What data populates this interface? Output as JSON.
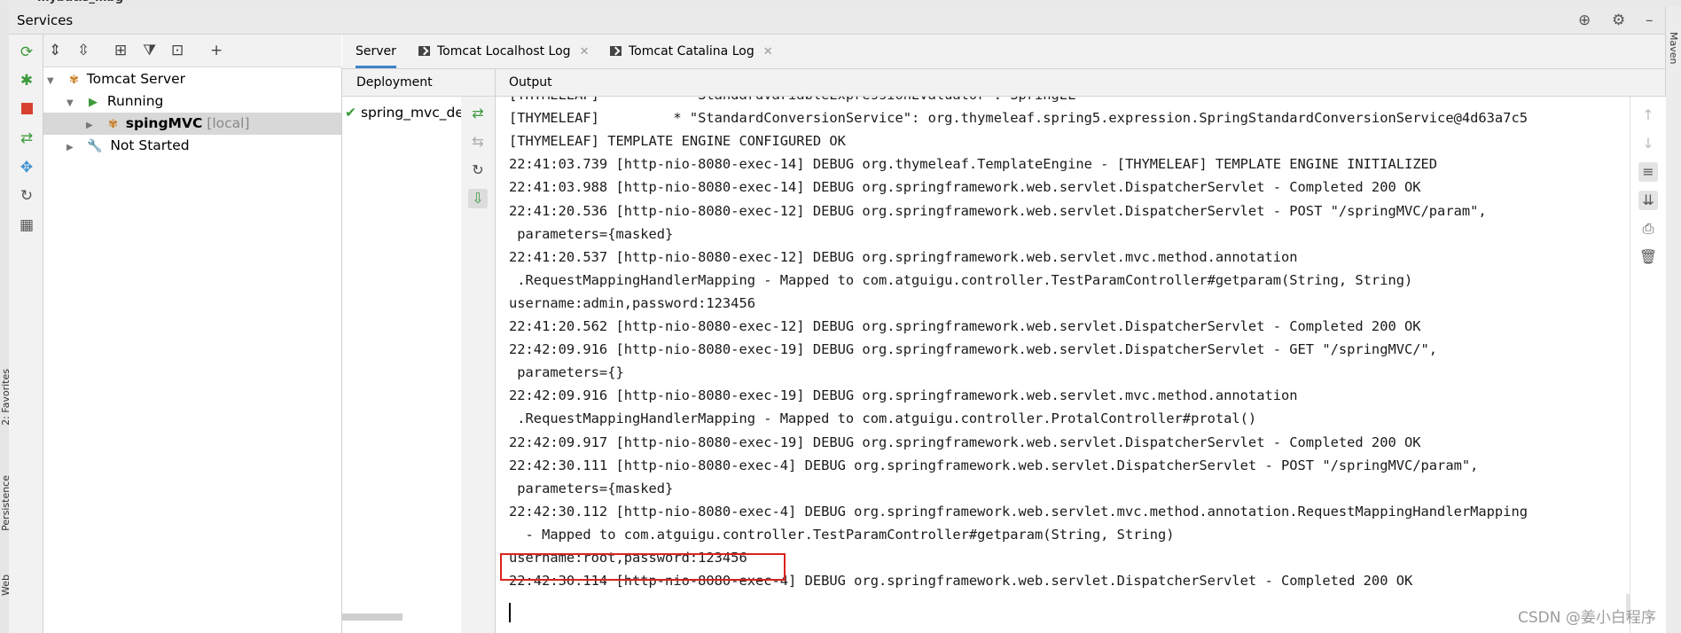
{
  "window": {
    "title": "Services",
    "prev_panel_fragment": "mybatis_mbg"
  },
  "sidebar_tabs": {
    "favorites": "2: Favorites",
    "persistence": "Persistence",
    "web": "Web",
    "maven": "Maven"
  },
  "tree": {
    "root": "Tomcat Server",
    "running": "Running",
    "app": "spingMVC",
    "app_suffix": "[local]",
    "not_started": "Not Started"
  },
  "tabs": [
    {
      "label": "Server",
      "active": true
    },
    {
      "label": "Tomcat Localhost Log",
      "active": false
    },
    {
      "label": "Tomcat Catalina Log",
      "active": false
    }
  ],
  "deployment": {
    "header": "Deployment",
    "item": "spring_mvc_de"
  },
  "output": {
    "header": "Output",
    "lines": [
      "[THYMELEAF]         * \"StandardVariableExpressionEvaluator\": SpringEL",
      "[THYMELEAF]         * \"StandardConversionService\": org.thymeleaf.spring5.expression.SpringStandardConversionService@4d63a7c5",
      "[THYMELEAF] TEMPLATE ENGINE CONFIGURED OK",
      "22:41:03.739 [http-nio-8080-exec-14] DEBUG org.thymeleaf.TemplateEngine - [THYMELEAF] TEMPLATE ENGINE INITIALIZED",
      "22:41:03.988 [http-nio-8080-exec-14] DEBUG org.springframework.web.servlet.DispatcherServlet - Completed 200 OK",
      "22:41:20.536 [http-nio-8080-exec-12] DEBUG org.springframework.web.servlet.DispatcherServlet - POST \"/springMVC/param\",",
      " parameters={masked}",
      "22:41:20.537 [http-nio-8080-exec-12] DEBUG org.springframework.web.servlet.mvc.method.annotation",
      " .RequestMappingHandlerMapping - Mapped to com.atguigu.controller.TestParamController#getparam(String, String)",
      "username:admin,password:123456",
      "22:41:20.562 [http-nio-8080-exec-12] DEBUG org.springframework.web.servlet.DispatcherServlet - Completed 200 OK",
      "22:42:09.916 [http-nio-8080-exec-19] DEBUG org.springframework.web.servlet.DispatcherServlet - GET \"/springMVC/\",",
      " parameters={}",
      "22:42:09.916 [http-nio-8080-exec-19] DEBUG org.springframework.web.servlet.mvc.method.annotation",
      " .RequestMappingHandlerMapping - Mapped to com.atguigu.controller.ProtalController#protal()",
      "22:42:09.917 [http-nio-8080-exec-19] DEBUG org.springframework.web.servlet.DispatcherServlet - Completed 200 OK",
      "22:42:30.111 [http-nio-8080-exec-4] DEBUG org.springframework.web.servlet.DispatcherServlet - POST \"/springMVC/param\",",
      " parameters={masked}",
      "22:42:30.112 [http-nio-8080-exec-4] DEBUG org.springframework.web.servlet.mvc.method.annotation.RequestMappingHandlerMapping",
      "  - Mapped to com.atguigu.controller.TestParamController#getparam(String, String)",
      "username:root,password:123456",
      "22:42:30.114 [http-nio-8080-exec-4] DEBUG org.springframework.web.servlet.DispatcherServlet - Completed 200 OK"
    ]
  },
  "watermark": "CSDN @姜小白程序",
  "colors": {
    "accent": "#4083c9",
    "highlight_box": "#d9231f",
    "run_green": "#3c9a3c",
    "stop_red": "#d9412f"
  }
}
